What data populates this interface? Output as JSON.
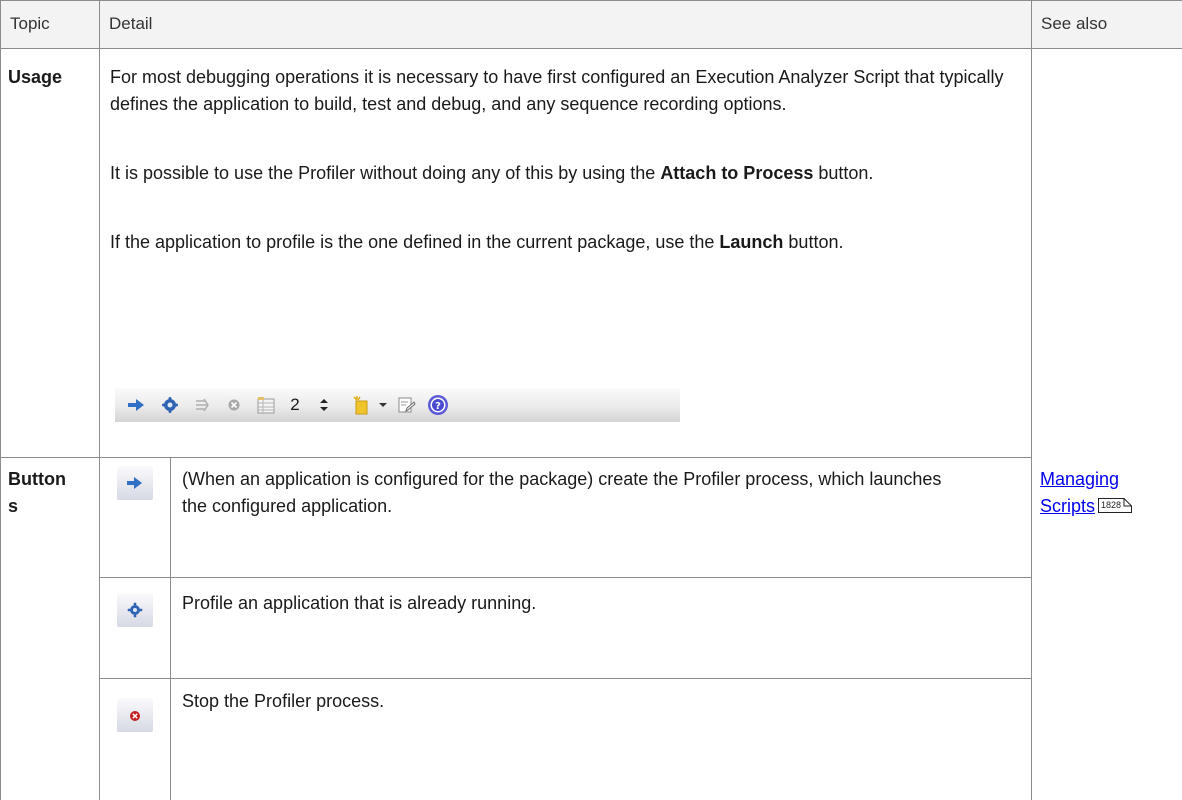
{
  "header": {
    "topic": "Topic",
    "detail": "Detail",
    "see_also": "See also"
  },
  "usage": {
    "topic": "Usage",
    "para1": "For most debugging operations it is necessary to have first configured an Execution Analyzer Script that typically defines the application to build, test and debug, and any sequence recording options.",
    "para2_pre": "It is possible to use the Profiler without doing any of this by using the ",
    "para2_bold": "Attach to Process",
    "para2_post": " button.",
    "para3_pre": "If the application to profile is the one defined in the current package, use the ",
    "para3_bold": "Launch",
    "para3_post": " button.",
    "toolbar": {
      "counter_value": "2",
      "icons": [
        "launch-icon",
        "attach-icon",
        "step-icon",
        "stop-icon",
        "table-icon",
        "spinner-icon",
        "folder-icon",
        "dropdown-icon",
        "report-icon",
        "help-icon"
      ]
    }
  },
  "buttons": {
    "topic_line1": "Button",
    "topic_line2": "s",
    "rows": [
      {
        "icon": "launch-arrow-icon",
        "text": "(When an application is configured for the package) create the Profiler process, which launches the configured application."
      },
      {
        "icon": "attach-gear-icon",
        "text": "Profile an application that is already running."
      },
      {
        "icon": "stop-icon",
        "text": "Stop the Profiler process."
      }
    ],
    "see_also": {
      "link_line1": "Managing",
      "link_line2": "Scripts",
      "page_ref": "1828"
    }
  }
}
